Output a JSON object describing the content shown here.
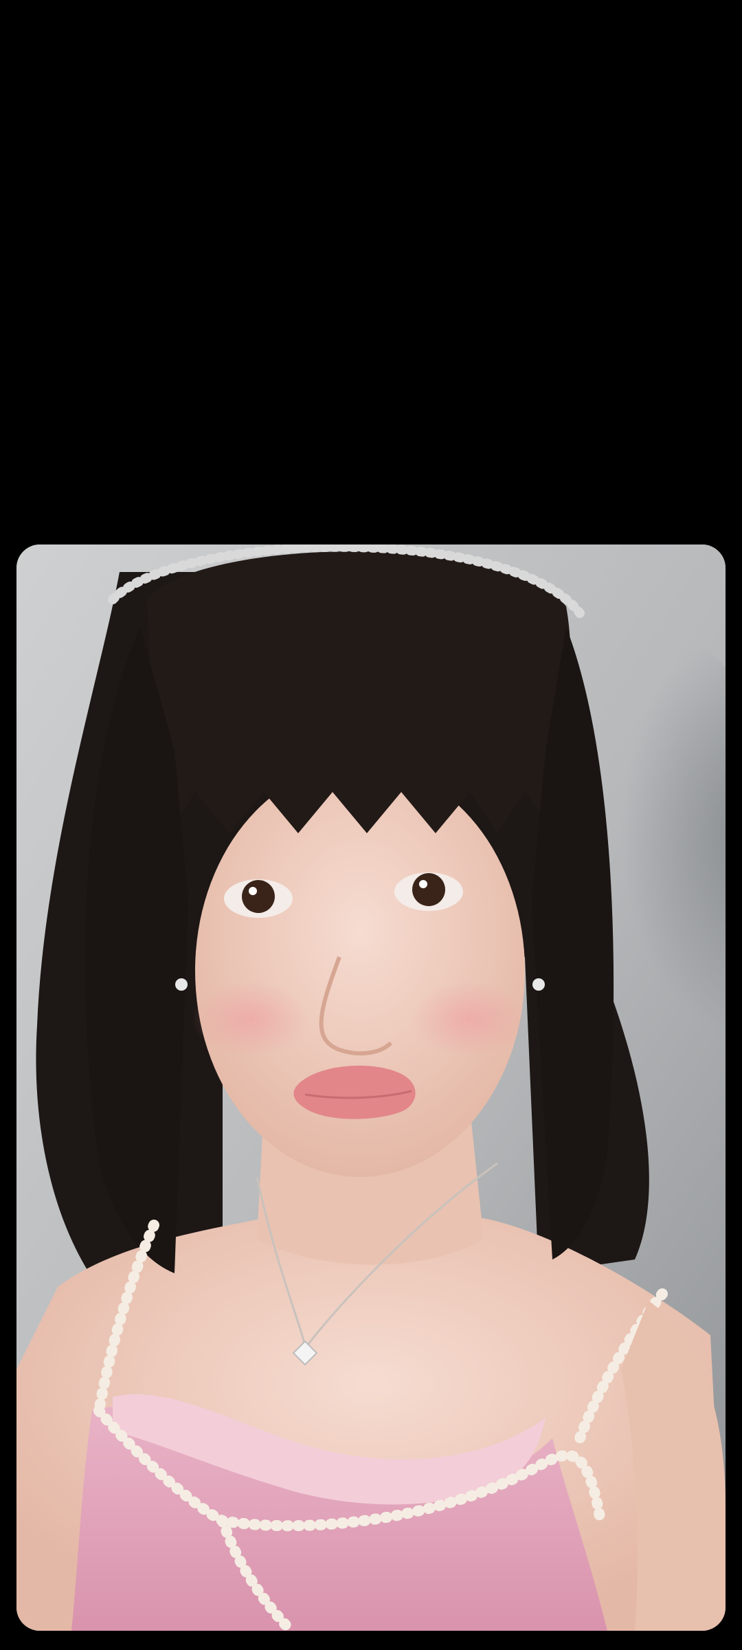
{
  "screen": {
    "background": "#000000"
  },
  "photo": {
    "description_icon": "photo-image",
    "colors": {
      "wall": "#b9bbbd",
      "hair": "#1c1614",
      "skin": "#efcdbf",
      "dress": "#e4a9bf",
      "dress_inner": "#f2cdd6",
      "pearls": "#f6efe6",
      "lips": "#e58d8f"
    }
  }
}
